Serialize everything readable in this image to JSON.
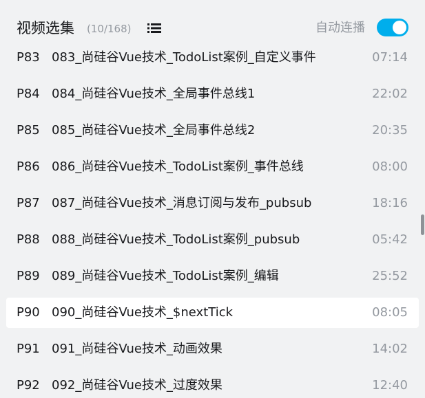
{
  "header": {
    "title": "视频选集",
    "count": "(10/168)",
    "list_icon": "list-icon",
    "autoplay_label": "自动连播",
    "autoplay_on": true
  },
  "colors": {
    "accent": "#00aeec",
    "background": "#f1f2f3",
    "active_row": "#ffffff",
    "text": "#18191c",
    "muted": "#9499a0"
  },
  "episodes": [
    {
      "pid": "P83",
      "title": "083_尚硅谷Vue技术_TodoList案例_自定义事件",
      "duration": "07:14",
      "active": false
    },
    {
      "pid": "P84",
      "title": "084_尚硅谷Vue技术_全局事件总线1",
      "duration": "22:02",
      "active": false
    },
    {
      "pid": "P85",
      "title": "085_尚硅谷Vue技术_全局事件总线2",
      "duration": "20:35",
      "active": false
    },
    {
      "pid": "P86",
      "title": "086_尚硅谷Vue技术_TodoList案例_事件总线",
      "duration": "08:00",
      "active": false
    },
    {
      "pid": "P87",
      "title": "087_尚硅谷Vue技术_消息订阅与发布_pubsub",
      "duration": "18:16",
      "active": false
    },
    {
      "pid": "P88",
      "title": "088_尚硅谷Vue技术_TodoList案例_pubsub",
      "duration": "05:42",
      "active": false
    },
    {
      "pid": "P89",
      "title": "089_尚硅谷Vue技术_TodoList案例_编辑",
      "duration": "25:52",
      "active": false
    },
    {
      "pid": "P90",
      "title": "090_尚硅谷Vue技术_$nextTick",
      "duration": "08:05",
      "active": true
    },
    {
      "pid": "P91",
      "title": "091_尚硅谷Vue技术_动画效果",
      "duration": "14:02",
      "active": false
    },
    {
      "pid": "P92",
      "title": "092_尚硅谷Vue技术_过度效果",
      "duration": "12:40",
      "active": false
    }
  ]
}
